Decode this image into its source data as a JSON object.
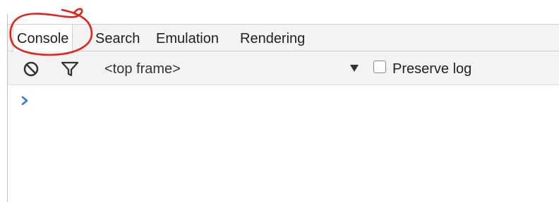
{
  "tabs": [
    {
      "label": "Console",
      "selected": true
    },
    {
      "label": "Search",
      "selected": false
    },
    {
      "label": "Emulation",
      "selected": false
    },
    {
      "label": "Rendering",
      "selected": false
    }
  ],
  "toolbar": {
    "clear_icon": "clear-console-icon",
    "filter_icon": "filter-icon",
    "frame_select": "<top frame>",
    "preserve_log_label": "Preserve log",
    "preserve_log_checked": false
  },
  "console": {
    "prompt_icon": "chevron-right-icon"
  },
  "colors": {
    "annotation": "#e8201a",
    "prompt": "#2f7be0",
    "panel_bg": "#f3f3f3"
  }
}
